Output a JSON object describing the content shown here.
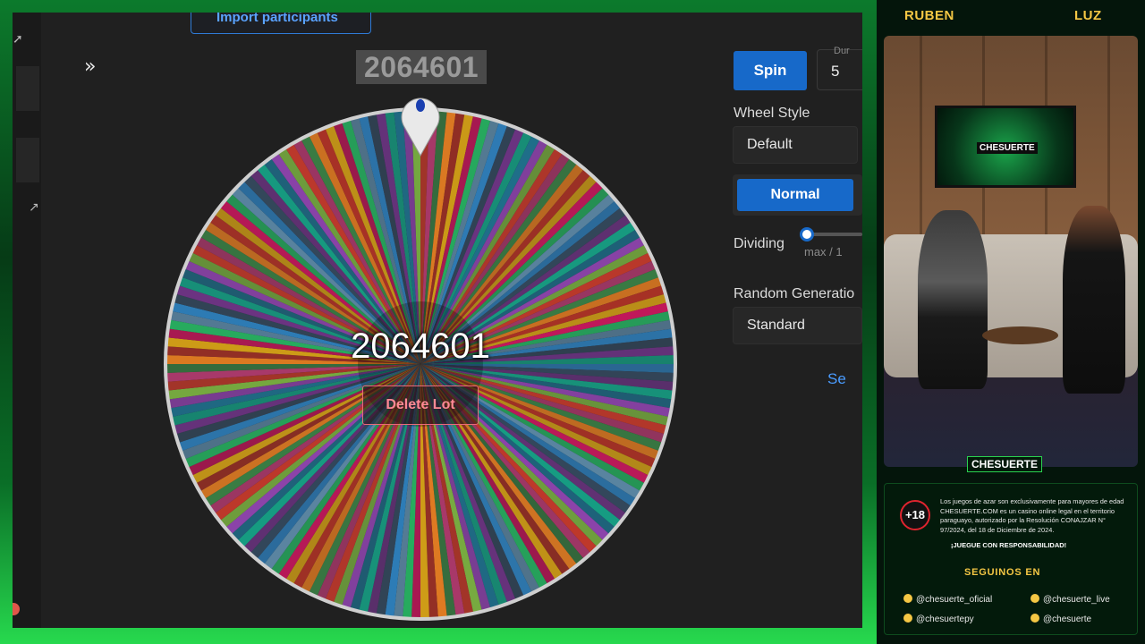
{
  "app": {
    "import_button": "Import participants",
    "wheel_title": "2064601",
    "center_value": "2064601",
    "delete_button": "Delete Lot",
    "spin_button": "Spin",
    "duration_label": "Dur",
    "duration_value": "5",
    "wheel_style_label": "Wheel Style",
    "wheel_style_value": "Default",
    "mode_button": "Normal",
    "dividing_label": "Dividing",
    "max_text": "max / 1",
    "random_gen_label": "Random Generatio",
    "random_gen_value": "Standard",
    "link_partial": "Se"
  },
  "stream": {
    "host_left": "RUBEN",
    "host_right": "LUZ",
    "tv_logo": "CHESUERTE",
    "brand_tag": "CHESUERTE",
    "age_badge": "+18",
    "disclaimer": "Los juegos de azar son exclusivamente para mayores de edad CHESUERTE.COM es un casino online legal en el territorio paraguayo, autorizado por la Resolución CONAJZAR N° 97/2024, del 18 de Diciembre de 2024.",
    "responsible": "¡JUEGUE CON RESPONSABILIDAD!",
    "follow_title": "SEGUINOS EN",
    "socials": [
      "@chesuerte_oficial",
      "@chesuerte_live",
      "@chesuertepy",
      "@chesuerte"
    ]
  },
  "colors": {
    "accent_blue": "#1769c9",
    "delete_red": "#e86a78",
    "brand_green": "#27d94e",
    "brand_gold": "#f5c744"
  },
  "icons": [
    "expand-icon",
    "cursor-icon",
    "pointer-icon",
    "instagram-icon",
    "tiktok-icon",
    "facebook-icon"
  ]
}
